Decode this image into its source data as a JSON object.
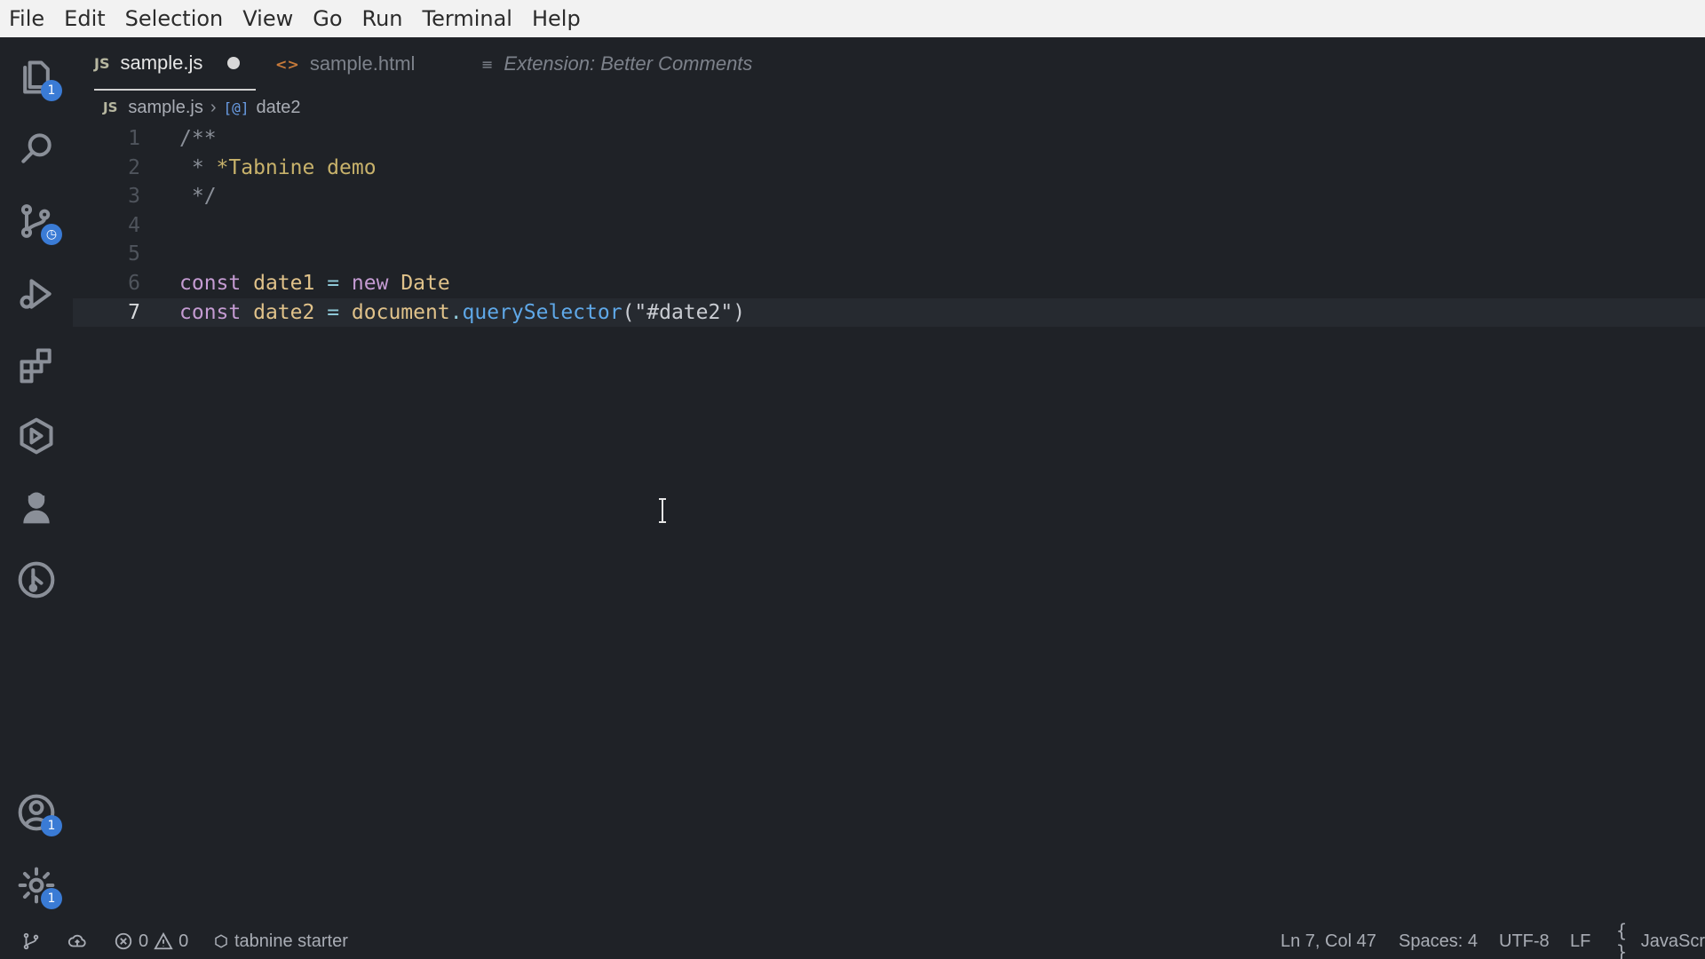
{
  "menu": [
    "File",
    "Edit",
    "Selection",
    "View",
    "Go",
    "Run",
    "Terminal",
    "Help"
  ],
  "activity": {
    "explorer_badge": "1",
    "accounts_badge": "1",
    "settings_badge": "1"
  },
  "tabs": [
    {
      "label": "sample.js",
      "icon": "JS",
      "active": true,
      "modified": true
    },
    {
      "label": "sample.html",
      "icon": "<>",
      "active": false
    },
    {
      "label": "Extension: Better Comments",
      "icon": "preview-icon",
      "active": false
    }
  ],
  "breadcrumb": {
    "file_icon": "JS",
    "file": "sample.js",
    "symbol_icon": "[@]",
    "symbol": "date2"
  },
  "editor": {
    "lines": [
      {
        "n": "1",
        "tokens": [
          {
            "t": "/**",
            "c": "c-comment"
          }
        ]
      },
      {
        "n": "2",
        "tokens": [
          {
            "t": " * ",
            "c": "c-comment"
          },
          {
            "t": "*Tabnine demo",
            "c": "c-tag"
          }
        ]
      },
      {
        "n": "3",
        "tokens": [
          {
            "t": " */",
            "c": "c-comment"
          }
        ]
      },
      {
        "n": "4",
        "tokens": []
      },
      {
        "n": "5",
        "tokens": []
      },
      {
        "n": "6",
        "tokens": [
          {
            "t": "const",
            "c": "c-kw"
          },
          {
            "t": " ",
            "c": ""
          },
          {
            "t": "date1",
            "c": "c-var"
          },
          {
            "t": " = ",
            "c": "c-op"
          },
          {
            "t": "new",
            "c": "c-kw"
          },
          {
            "t": " ",
            "c": ""
          },
          {
            "t": "Date",
            "c": "c-var"
          }
        ]
      },
      {
        "n": "7",
        "tokens": [
          {
            "t": "const",
            "c": "c-kw"
          },
          {
            "t": " ",
            "c": ""
          },
          {
            "t": "date2",
            "c": "c-var"
          },
          {
            "t": " = ",
            "c": "c-op"
          },
          {
            "t": "document",
            "c": "c-obj"
          },
          {
            "t": ".",
            "c": "c-op"
          },
          {
            "t": "querySelector",
            "c": "c-fn"
          },
          {
            "t": "(",
            "c": "c-paren"
          },
          {
            "t": "\"#date2\"",
            "c": "c-str"
          },
          {
            "t": ")",
            "c": "c-paren"
          }
        ]
      }
    ],
    "current_line": "7"
  },
  "status": {
    "errors": "0",
    "warnings": "0",
    "tabnine": "tabnine starter",
    "position": "Ln 7, Col 47",
    "spaces": "Spaces: 4",
    "encoding": "UTF-8",
    "eol": "LF",
    "language": "JavaScr"
  },
  "colors": {
    "background": "#1f2227",
    "accent": "#3a7bd5",
    "menubar": "#f2f2f2"
  }
}
